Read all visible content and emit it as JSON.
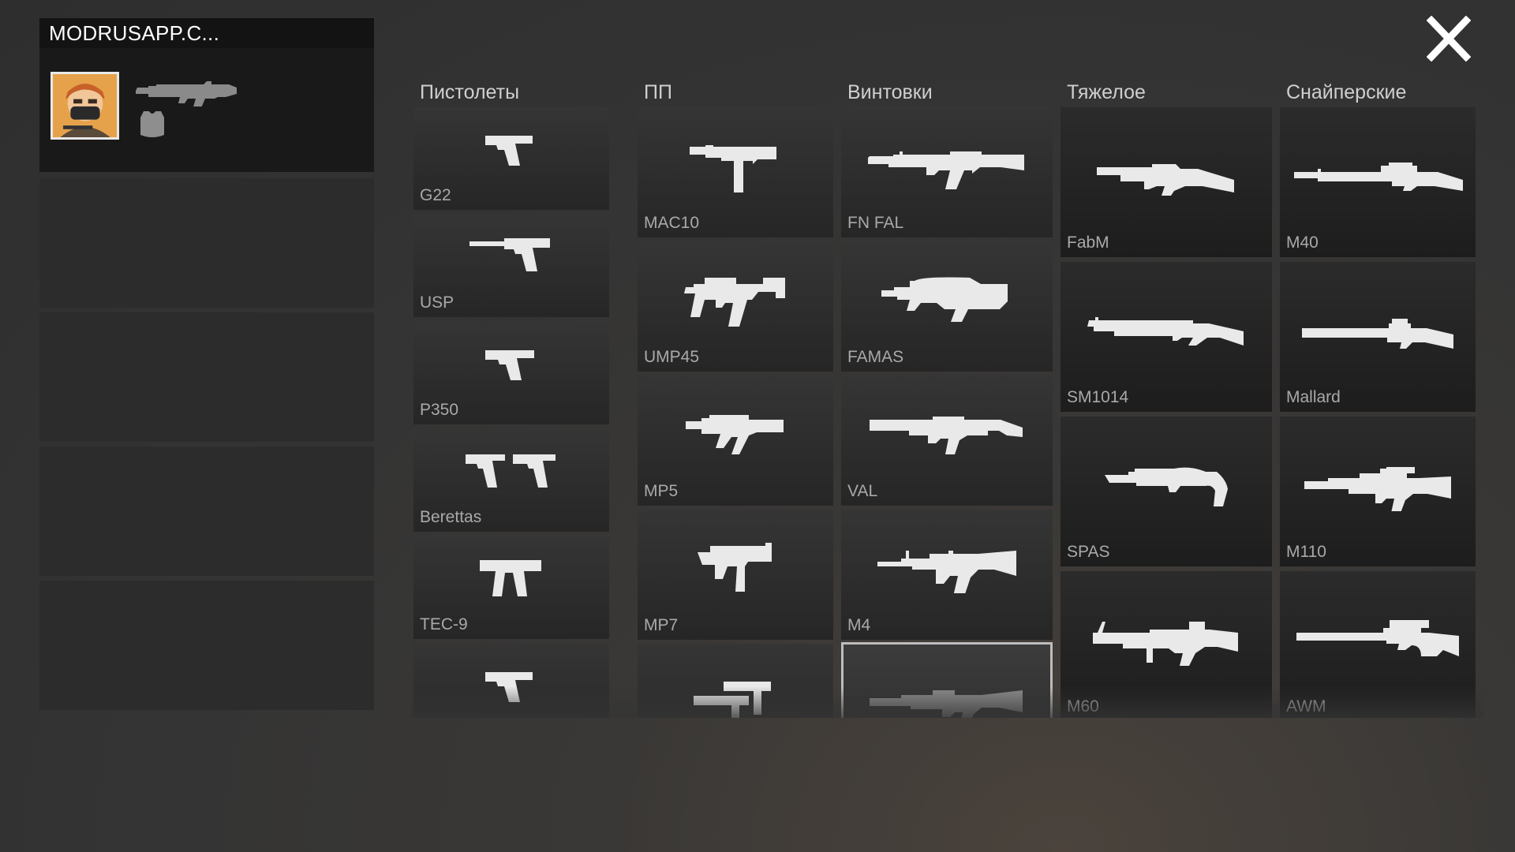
{
  "player": {
    "name": "MODRUSAPP.C..."
  },
  "categories": {
    "pistols": "Пистолеты",
    "smg": "ПП",
    "rifles": "Винтовки",
    "heavy": "Тяжелое",
    "snipers": "Снайперские"
  },
  "weapons": {
    "pistols": [
      "G22",
      "USP",
      "P350",
      "Berettas",
      "TEC-9",
      ""
    ],
    "smg": [
      "MAC10",
      "UMP45",
      "MP5",
      "MP7",
      ""
    ],
    "rifles": [
      "FN FAL",
      "FAMAS",
      "VAL",
      "M4",
      ""
    ],
    "heavy": [
      "FabM",
      "SM1014",
      "SPAS",
      "M60"
    ],
    "snipers": [
      "M40",
      "Mallard",
      "M110",
      "AWM"
    ]
  },
  "icons": {
    "close": "close-icon",
    "pistol": "pistol-icon",
    "smg": "smg-icon",
    "rifle": "rifle-icon",
    "shotgun": "shotgun-icon",
    "sniper": "sniper-icon",
    "armor": "armor-icon",
    "avatar": "avatar-icon"
  },
  "colors": {
    "icon": "#e9e9e9",
    "label": "#a9a9a9",
    "header": "#cfcfcf"
  }
}
